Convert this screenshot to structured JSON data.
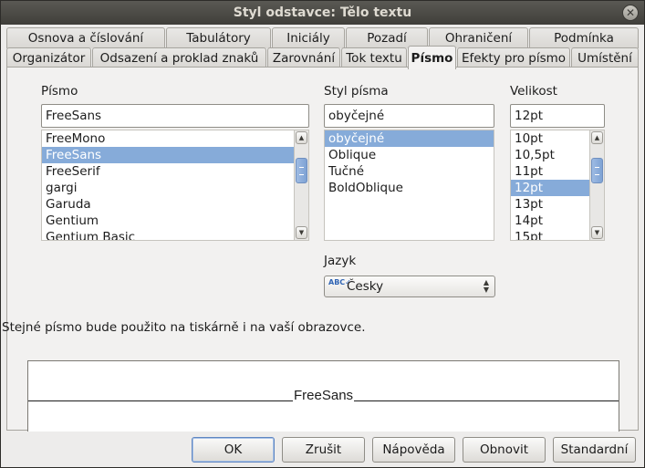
{
  "window": {
    "title": "Styl odstavce: Tělo textu",
    "close_symbol": "✕"
  },
  "tabs_row1": [
    "Osnova a číslování",
    "Tabulátory",
    "Iniciály",
    "Pozadí",
    "Ohraničení",
    "Podmínka"
  ],
  "tabs_row2": [
    "Organizátor",
    "Odsazení a proklad znaků",
    "Zarovnání",
    "Tok textu",
    "Písmo",
    "Efekty pro písmo",
    "Umístění"
  ],
  "active_tab": "Písmo",
  "font": {
    "label": "Písmo",
    "value": "FreeSans",
    "items": [
      "FreeMono",
      "FreeSans",
      "FreeSerif",
      "gargi",
      "Garuda",
      "Gentium",
      "Gentium Basic"
    ],
    "selected": "FreeSans"
  },
  "style": {
    "label": "Styl písma",
    "value": "obyčejné",
    "items": [
      "obyčejné",
      "Oblique",
      "Tučné",
      "BoldOblique"
    ],
    "selected": "obyčejné"
  },
  "size": {
    "label": "Velikost",
    "value": "12pt",
    "items": [
      "10pt",
      "10,5pt",
      "11pt",
      "12pt",
      "13pt",
      "14pt",
      "15pt"
    ],
    "selected": "12pt"
  },
  "language": {
    "label": "Jazyk",
    "value": "Česky",
    "icon": "spellcheck-abc-icon",
    "icon_text": "ABC✓"
  },
  "info_text": "Stejné písmo bude použito na tiskárně i na vaší obrazovce.",
  "preview": {
    "text": "FreeSans"
  },
  "buttons": {
    "ok": "OK",
    "cancel": "Zrušit",
    "help": "Nápověda",
    "reset": "Obnovit",
    "standard": "Standardní"
  },
  "colors": {
    "selection": "#86abd9",
    "titlebar": "#4a4945",
    "dialog_bg": "#edeceb"
  }
}
